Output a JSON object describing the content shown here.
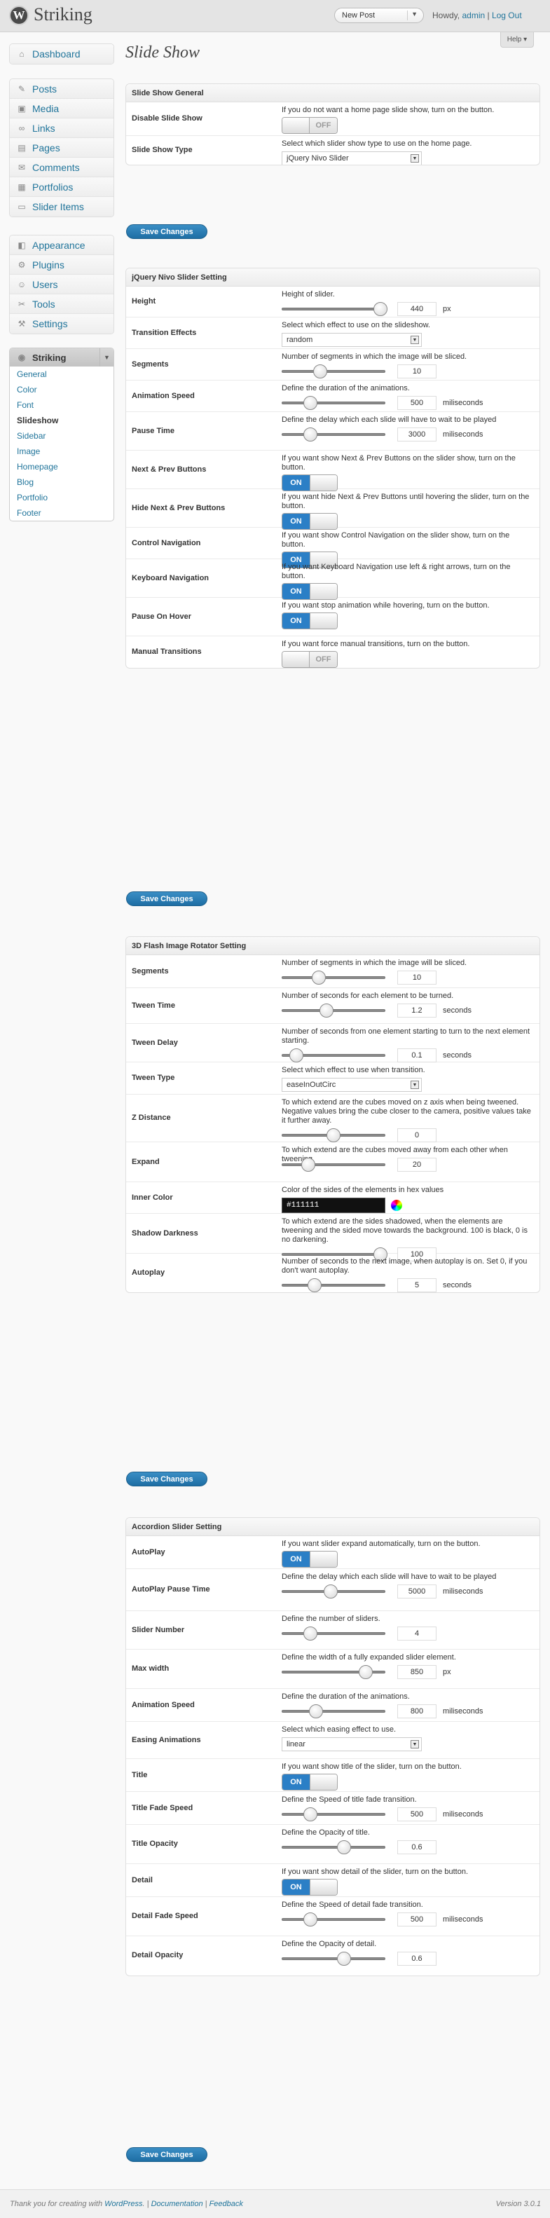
{
  "header": {
    "site_name": "Striking",
    "logo_letter": "W",
    "new_post": "New Post",
    "howdy": "Howdy,",
    "user": "admin",
    "logout": "Log Out",
    "help": "Help"
  },
  "menu": {
    "group1": [
      {
        "label": "Dashboard",
        "icon": "dashboard-icon",
        "glyph": "⌂"
      }
    ],
    "group2": [
      {
        "label": "Posts",
        "icon": "pin-icon",
        "glyph": "✎"
      },
      {
        "label": "Media",
        "icon": "media-icon",
        "glyph": "▣"
      },
      {
        "label": "Links",
        "icon": "link-icon",
        "glyph": "∞"
      },
      {
        "label": "Pages",
        "icon": "page-icon",
        "glyph": "▤"
      },
      {
        "label": "Comments",
        "icon": "comment-icon",
        "glyph": "✉"
      },
      {
        "label": "Portfolios",
        "icon": "portfolio-icon",
        "glyph": "▦"
      },
      {
        "label": "Slider Items",
        "icon": "slider-icon",
        "glyph": "▭"
      }
    ],
    "group3": [
      {
        "label": "Appearance",
        "icon": "appearance-icon",
        "glyph": "◧"
      },
      {
        "label": "Plugins",
        "icon": "plugin-icon",
        "glyph": "⚙"
      },
      {
        "label": "Users",
        "icon": "users-icon",
        "glyph": "☺"
      },
      {
        "label": "Tools",
        "icon": "tools-icon",
        "glyph": "✂"
      },
      {
        "label": "Settings",
        "icon": "settings-icon",
        "glyph": "⚒"
      }
    ],
    "striking": {
      "label": "Striking",
      "items": [
        "General",
        "Color",
        "Font",
        "Slideshow",
        "Sidebar",
        "Image",
        "Homepage",
        "Blog",
        "Portfolio",
        "Footer"
      ],
      "current": "Slideshow"
    }
  },
  "page_title": "Slide Show",
  "save_label": "Save Changes",
  "sections": [
    {
      "title": "Slide Show General",
      "rows": [
        {
          "label": "Disable Slide Show",
          "desc": "If you do not want a home page slide show, turn on the button.",
          "type": "toggle",
          "state": "OFF"
        },
        {
          "label": "Slide Show Type",
          "desc": "Select which slider show type to use on the home page.",
          "type": "select",
          "value": "jQuery Nivo Slider"
        }
      ]
    },
    {
      "title": "jQuery Nivo Slider Setting",
      "rows": [
        {
          "label": "Height",
          "desc": "Height of slider.",
          "type": "slider",
          "value": "440",
          "fraction": 0.95,
          "unit": "px"
        },
        {
          "label": "Transition Effects",
          "desc": "Select which effect to use on the slideshow.",
          "type": "select",
          "value": "random"
        },
        {
          "label": "Segments",
          "desc": "Number of segments in which the image will be sliced.",
          "type": "slider",
          "value": "10",
          "fraction": 0.37,
          "unit": ""
        },
        {
          "label": "Animation Speed",
          "desc": "Define the duration of the animations.",
          "type": "slider",
          "value": "500",
          "fraction": 0.28,
          "unit": "miliseconds"
        },
        {
          "label": "Pause Time",
          "desc": "Define the delay which each slide will have to wait to be played",
          "type": "slider",
          "value": "3000",
          "fraction": 0.28,
          "unit": "miliseconds"
        },
        {
          "label": "Next & Prev Buttons",
          "desc": "If you want show Next & Prev Buttons on the slider show, turn on the button.",
          "type": "toggle",
          "state": "ON"
        },
        {
          "label": "Hide Next & Prev Buttons",
          "desc": "If you want hide Next & Prev Buttons until hovering the slider, turn on the button.",
          "type": "toggle",
          "state": "ON"
        },
        {
          "label": "Control Navigation",
          "desc": "If you want show Control Navigation on the slider show, turn on the button.",
          "type": "toggle",
          "state": "ON"
        },
        {
          "label": "Keyboard Navigation",
          "desc": "If you want Keyboard Navigation use left & right arrows, turn on the button.",
          "type": "toggle",
          "state": "ON"
        },
        {
          "label": "Pause On Hover",
          "desc": "If you want stop animation while hovering, turn on the button.",
          "type": "toggle",
          "state": "ON"
        },
        {
          "label": "Manual Transitions",
          "desc": "If you want force manual transitions, turn on the button.",
          "type": "toggle",
          "state": "OFF"
        }
      ]
    },
    {
      "title": "3D Flash Image Rotator Setting",
      "rows": [
        {
          "label": "Segments",
          "desc": "Number of segments in which the image will be sliced.",
          "type": "slider",
          "value": "10",
          "fraction": 0.36,
          "unit": ""
        },
        {
          "label": "Tween Time",
          "desc": "Number of seconds for each element to be turned.",
          "type": "slider",
          "value": "1.2",
          "fraction": 0.43,
          "unit": "seconds"
        },
        {
          "label": "Tween Delay",
          "desc": "Number of seconds from one element starting to turn to the next element starting.",
          "type": "slider",
          "value": "0.1",
          "fraction": 0.14,
          "unit": "seconds"
        },
        {
          "label": "Tween Type",
          "desc": "Select which effect to use when transition.",
          "type": "select",
          "value": "easeInOutCirc"
        },
        {
          "label": "Z Distance",
          "desc": "To which extend are the cubes moved on z axis when being tweened. Negative values bring the cube closer to the camera, positive values take it further away.",
          "type": "slider",
          "value": "0",
          "fraction": 0.5,
          "unit": ""
        },
        {
          "label": "Expand",
          "desc": "To which extend are the cubes moved away from each other when tweening.",
          "type": "slider",
          "value": "20",
          "fraction": 0.26,
          "unit": ""
        },
        {
          "label": "Inner Color",
          "desc": "Color of the sides of the elements in hex values",
          "type": "color",
          "value": "#111111"
        },
        {
          "label": "Shadow Darkness",
          "desc": "To which extend are the sides shadowed, when the elements are tweening and the sided move towards the background. 100 is black, 0 is no darkening.",
          "type": "slider",
          "value": "100",
          "fraction": 0.95,
          "unit": ""
        },
        {
          "label": "Autoplay",
          "desc": "Number of seconds to the next image, when autoplay is on. Set 0, if you don't want autoplay.",
          "type": "slider",
          "value": "5",
          "fraction": 0.32,
          "unit": "seconds"
        }
      ]
    },
    {
      "title": "Accordion Slider Setting",
      "rows": [
        {
          "label": "AutoPlay",
          "desc": "If you want slider expand automatically, turn on the button.",
          "type": "toggle",
          "state": "ON"
        },
        {
          "label": "AutoPlay Pause Time",
          "desc": "Define the delay which each slide will have to wait to be played",
          "type": "slider",
          "value": "5000",
          "fraction": 0.47,
          "unit": "miliseconds"
        },
        {
          "label": "Slider Number",
          "desc": "Define the number of sliders.",
          "type": "slider",
          "value": "4",
          "fraction": 0.28,
          "unit": ""
        },
        {
          "label": "Max width",
          "desc": "Define the width of a fully expanded slider element.",
          "type": "slider",
          "value": "850",
          "fraction": 0.81,
          "unit": "px"
        },
        {
          "label": "Animation Speed",
          "desc": "Define the duration of the animations.",
          "type": "slider",
          "value": "800",
          "fraction": 0.33,
          "unit": "miliseconds"
        },
        {
          "label": "Easing Animations",
          "desc": "Select which easing effect to use.",
          "type": "select",
          "value": "linear"
        },
        {
          "label": "Title",
          "desc": "If you want show title of the slider, turn on the button.",
          "type": "toggle",
          "state": "ON"
        },
        {
          "label": "Title Fade Speed",
          "desc": "Define the Speed of title fade transition.",
          "type": "slider",
          "value": "500",
          "fraction": 0.28,
          "unit": "miliseconds"
        },
        {
          "label": "Title Opacity",
          "desc": "Define the Opacity of title.",
          "type": "slider",
          "value": "0.6",
          "fraction": 0.6,
          "unit": ""
        },
        {
          "label": "Detail",
          "desc": "If you want show detail of the slider, turn on the button.",
          "type": "toggle",
          "state": "ON"
        },
        {
          "label": "Detail Fade Speed",
          "desc": "Define the Speed of detail fade transition.",
          "type": "slider",
          "value": "500",
          "fraction": 0.28,
          "unit": "miliseconds"
        },
        {
          "label": "Detail Opacity",
          "desc": "Define the Opacity of detail.",
          "type": "slider",
          "value": "0.6",
          "fraction": 0.6,
          "unit": ""
        }
      ]
    }
  ],
  "footer": {
    "thanks": "Thank you for creating with",
    "wordpress": "WordPress",
    "sep1": ".",
    "documentation": "Documentation",
    "feedback": "Feedback",
    "version": "Version 3.0.1"
  },
  "colors": {
    "accent": "#21759b",
    "toggle_on": "#2b7fc6",
    "button": "#1e6ea4"
  }
}
